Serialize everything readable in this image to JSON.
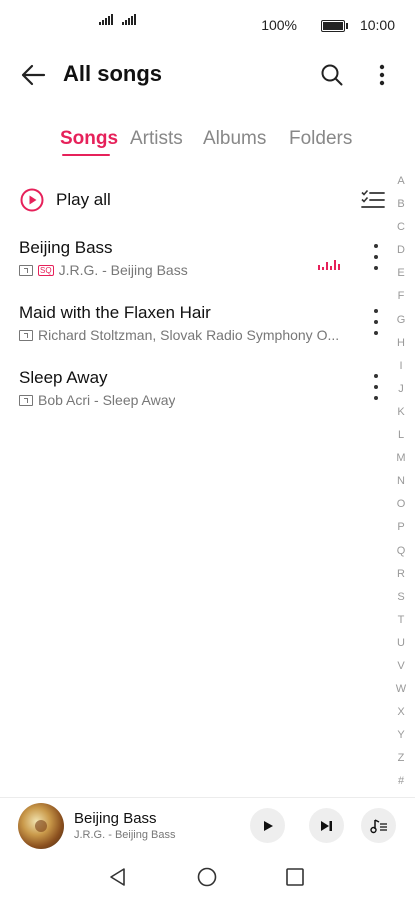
{
  "status_bar": {
    "battery_percent": "100%",
    "battery_level": 1.0,
    "time": "10:00"
  },
  "header": {
    "title": "All songs",
    "back_icon": "arrow-left-icon",
    "search_icon": "search-icon",
    "more_icon": "more-vertical-icon"
  },
  "tabs": [
    {
      "label": "Songs",
      "active": true
    },
    {
      "label": "Artists",
      "active": false
    },
    {
      "label": "Albums",
      "active": false
    },
    {
      "label": "Folders",
      "active": false
    }
  ],
  "play_all": {
    "label": "Play all",
    "icon": "play-circle-icon",
    "select_icon": "multi-select-list-icon"
  },
  "songs": [
    {
      "title": "Beijing Bass",
      "meta": "J.R.G. - Beijing Bass",
      "sq": "SQ",
      "playing": true
    },
    {
      "title": "Maid with the Flaxen Hair",
      "meta": "Richard Stoltzman, Slovak Radio Symphony O...",
      "sq": "",
      "playing": false
    },
    {
      "title": "Sleep Away",
      "meta": "Bob Acri - Sleep Away",
      "sq": "",
      "playing": false
    }
  ],
  "alpha_index": [
    "A",
    "B",
    "C",
    "D",
    "E",
    "F",
    "G",
    "H",
    "I",
    "J",
    "K",
    "L",
    "M",
    "N",
    "O",
    "P",
    "Q",
    "R",
    "S",
    "T",
    "U",
    "V",
    "W",
    "X",
    "Y",
    "Z",
    "#"
  ],
  "now_playing": {
    "title": "Beijing Bass",
    "artist": "J.R.G. - Beijing Bass",
    "play_icon": "play-icon",
    "next_icon": "skip-next-icon",
    "queue_icon": "playlist-icon"
  },
  "nav_bar": {
    "back_icon": "nav-back-icon",
    "home_icon": "nav-home-icon",
    "recents_icon": "nav-recents-icon"
  },
  "colors": {
    "accent": "#e6215a"
  }
}
